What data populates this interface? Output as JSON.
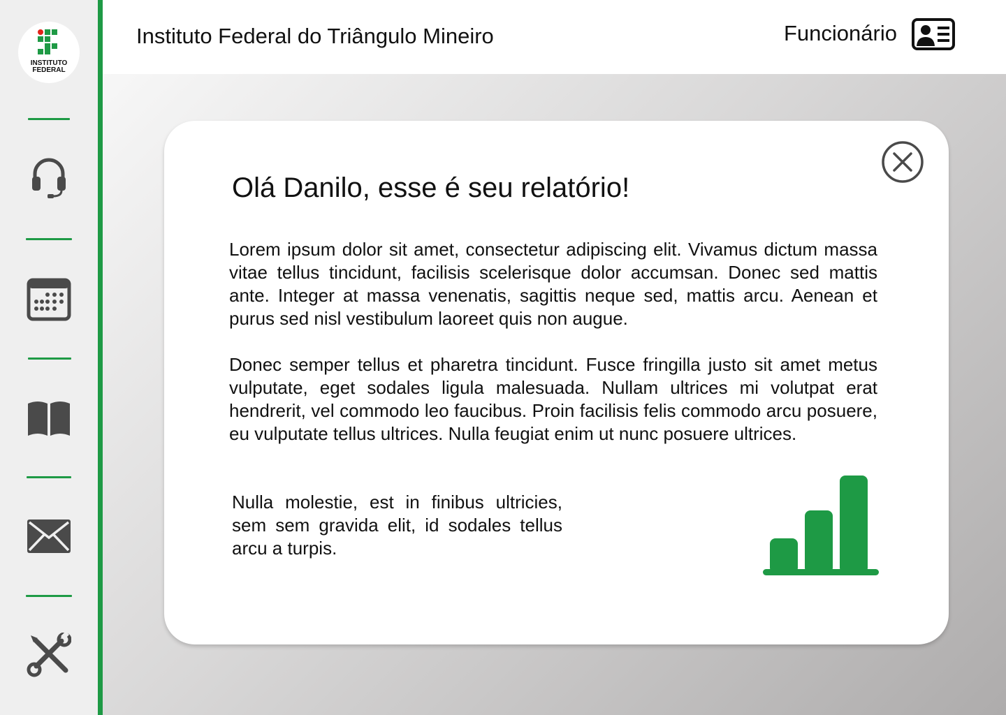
{
  "sidebar": {
    "logo": {
      "line1": "INSTITUTO",
      "line2": "FEDERAL",
      "icon": "instituto-federal-logo"
    },
    "items": [
      {
        "name": "support",
        "icon": "headset-icon"
      },
      {
        "name": "calendar",
        "icon": "calendar-icon"
      },
      {
        "name": "library",
        "icon": "book-icon"
      },
      {
        "name": "messages",
        "icon": "mail-icon"
      },
      {
        "name": "settings",
        "icon": "tools-icon"
      }
    ]
  },
  "header": {
    "title": "Instituto Federal do Triângulo Mineiro",
    "user_role": "Funcionário",
    "user_icon": "id-card-icon"
  },
  "modal": {
    "title": "Olá Danilo, esse é seu relatório!",
    "paragraphs": [
      "Lorem ipsum dolor sit amet, consectetur adipiscing elit. Vivamus dictum massa vitae tellus tincidunt, facilisis scelerisque dolor accumsan.  Donec sed mattis ante. Integer at massa venenatis, sagittis neque sed,  mattis arcu. Aenean et purus sed nisl vestibulum laoreet quis non augue.",
      "Donec semper tellus et pharetra tincidunt. Fusce fringilla justo sit  amet metus vulputate, eget sodales ligula malesuada. Nullam ultrices mi volutpat erat hendrerit, vel commodo leo faucibus. Proin facilisis felis commodo arcu posuere, eu vulputate tellus ultrices. Nulla feugiat enim  ut nunc posuere ultrices.",
      "Nulla molestie, est in finibus ultricies, sem  sem gravida elit, id sodales tellus arcu a turpis."
    ],
    "close_icon": "close-circle-icon",
    "chart_icon": "bar-chart-icon"
  },
  "colors": {
    "accent": "#1e9a45",
    "logo_red": "#e2231a",
    "icon_gray": "#4a4a4a"
  }
}
